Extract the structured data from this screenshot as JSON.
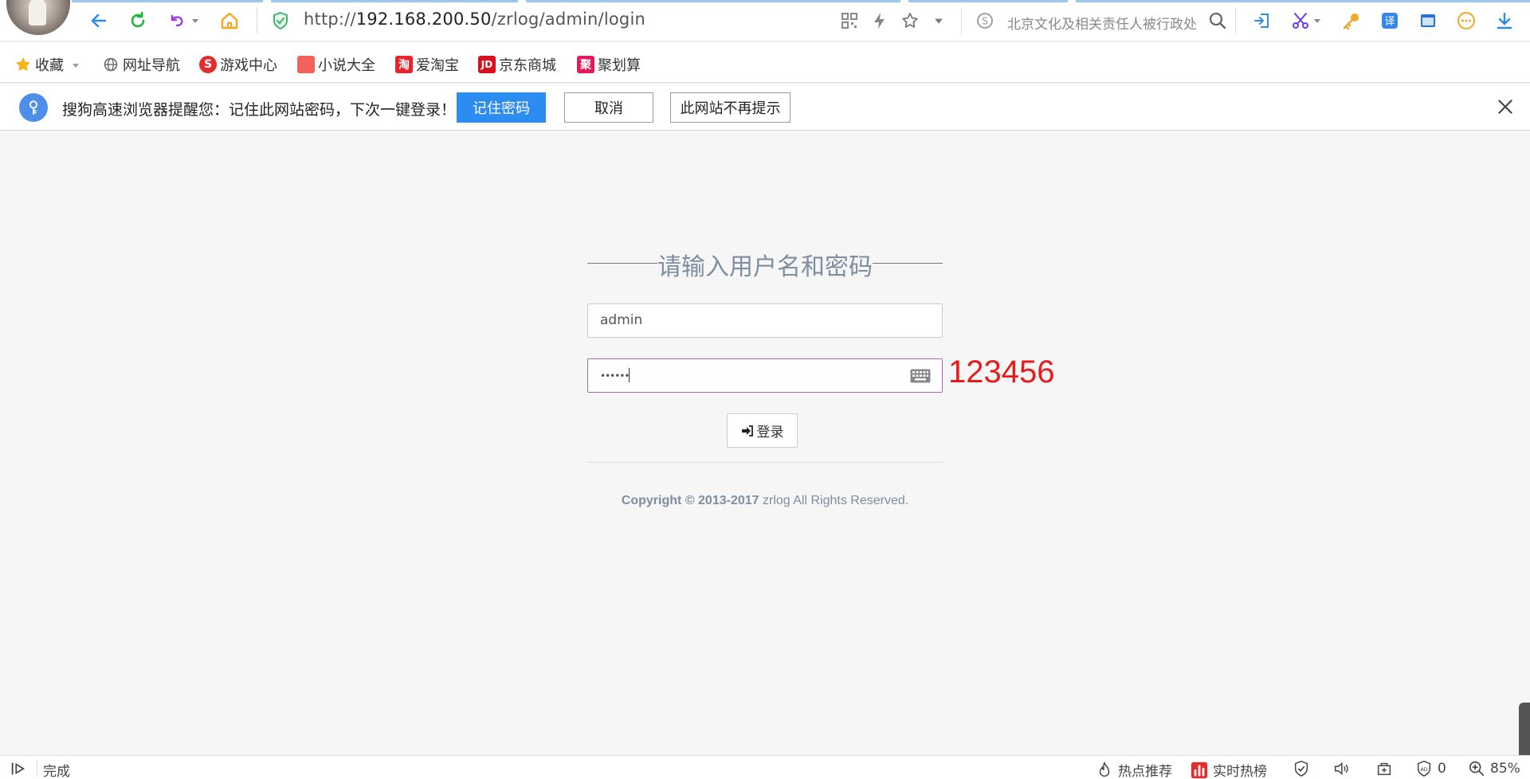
{
  "browser": {
    "url_prefix": "http://",
    "url_host": "192.168.200.50",
    "url_path": "/zrlog/admin/login",
    "search_text": "北京文化及相关责任人被行政处"
  },
  "bookmarks": [
    {
      "label": "收藏"
    },
    {
      "label": "网址导航"
    },
    {
      "label": "游戏中心"
    },
    {
      "label": "小说大全"
    },
    {
      "label": "爱淘宝"
    },
    {
      "label": "京东商城"
    },
    {
      "label": "聚划算"
    }
  ],
  "password_prompt": {
    "message": "搜狗高速浏览器提醒您：记住此网站密码，下次一键登录！",
    "remember_label": "记住密码",
    "cancel_label": "取消",
    "never_label": "此网站不再提示"
  },
  "login": {
    "title": "请输入用户名和密码",
    "username_value": "admin",
    "password_value": "••••••",
    "annotation": "123456",
    "submit_label": "登录",
    "copyright_bold": "Copyright © 2013-2017",
    "copyright_rest": " zrlog All Rights Reserved."
  },
  "statusbar": {
    "status": "完成",
    "hot_recommend": "热点推荐",
    "realtime_hot": "实时热榜",
    "adblock_count": "0",
    "zoom": "85%"
  },
  "colors": {
    "accent_blue": "#2d8cf0",
    "title_gray_blue": "#7c8ea0",
    "annotation_red": "#e51c1c",
    "focus_border": "#a56bb0"
  }
}
